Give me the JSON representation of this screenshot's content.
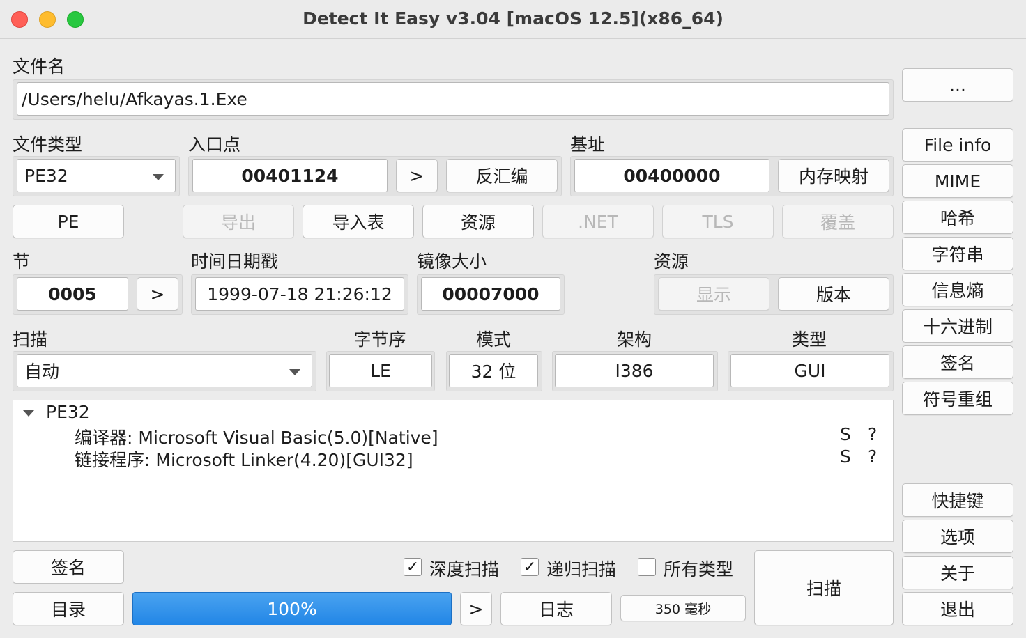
{
  "window": {
    "title": "Detect It Easy v3.04 [macOS 12.5](x86_64)",
    "traffic_colors": {
      "close": "#ff5f57",
      "minimize": "#febc2e",
      "zoom": "#28c840"
    }
  },
  "file": {
    "label": "文件名",
    "path": "/Users/helu/Afkayas.1.Exe",
    "browse_label": "..."
  },
  "filetype": {
    "label": "文件类型",
    "value": "PE32"
  },
  "entry": {
    "label": "入口点",
    "value": "00401124",
    "go_label": ">",
    "disasm_label": "反汇编"
  },
  "base": {
    "label": "基址",
    "value": "00400000",
    "memmap_label": "内存映射"
  },
  "pe_buttons": {
    "pe": "PE",
    "exports": "导出",
    "imports": "导入表",
    "resources": "资源",
    "net": ".NET",
    "tls": "TLS",
    "overlay": "覆盖"
  },
  "section": {
    "label": "节",
    "value": "0005",
    "go_label": ">"
  },
  "timestamp": {
    "label": "时间日期戳",
    "value": "1999-07-18 21:26:12"
  },
  "image_size": {
    "label": "镜像大小",
    "value": "00007000"
  },
  "res": {
    "label": "资源",
    "show_label": "显示",
    "version_label": "版本"
  },
  "scan": {
    "label": "扫描",
    "value": "自动"
  },
  "endian": {
    "label": "字节序",
    "value": "LE"
  },
  "mode": {
    "label": "模式",
    "value": "32 位"
  },
  "arch": {
    "label": "架构",
    "value": "I386"
  },
  "type": {
    "label": "类型",
    "value": "GUI"
  },
  "results": {
    "root": "PE32",
    "items": [
      {
        "text": "编译器: Microsoft Visual Basic(5.0)[Native]",
        "s": "S",
        "q": "?"
      },
      {
        "text": "链接程序: Microsoft Linker(4.20)[GUI32]",
        "s": "S",
        "q": "?"
      }
    ]
  },
  "bottom": {
    "signatures": "签名",
    "directory": "目录",
    "progress_text": "100%",
    "progress": 1.0,
    "progress_go": ">",
    "log": "日志",
    "elapsed": "350 毫秒",
    "scan_button": "扫描",
    "deep_scan": {
      "label": "深度扫描",
      "checked": true
    },
    "recursive_scan": {
      "label": "递归扫描",
      "checked": true
    },
    "all_types": {
      "label": "所有类型",
      "checked": false
    },
    "check_glyph": "✓"
  },
  "sidebar": {
    "file_info": "File info",
    "mime": "MIME",
    "hash": "哈希",
    "strings": "字符串",
    "entropy": "信息熵",
    "hex": "十六进制",
    "signatures": "签名",
    "demangle": "符号重组",
    "shortcuts": "快捷键",
    "options": "选项",
    "about": "关于",
    "exit": "退出"
  }
}
